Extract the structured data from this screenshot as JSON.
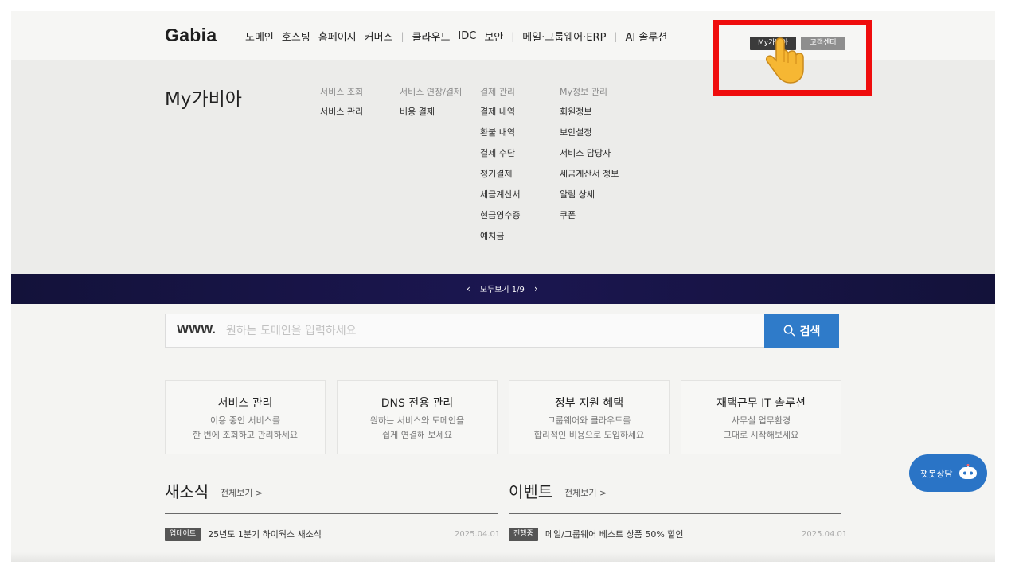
{
  "header": {
    "logo": "Gabia",
    "nav_groups": [
      [
        "도메인",
        "호스팅",
        "홈페이지",
        "커머스"
      ],
      [
        "클라우드",
        "IDC",
        "보안"
      ],
      [
        "메일·그룹웨어·ERP"
      ],
      [
        "AI 솔루션"
      ]
    ],
    "util": {
      "my_label": "My가비아",
      "cs_label": "고객센터"
    }
  },
  "megamenu": {
    "title": "My가비아",
    "columns": [
      {
        "head": "서비스 조회",
        "links": [
          "서비스 관리"
        ]
      },
      {
        "head": "서비스 연장/결제",
        "links": [
          "비용 결제"
        ]
      },
      {
        "head": "결제 관리",
        "links": [
          "결제 내역",
          "환불 내역",
          "결제 수단",
          "정기결제",
          "세금계산서",
          "현금영수증",
          "예치금"
        ]
      },
      {
        "head": "My정보 관리",
        "links": [
          "회원정보",
          "보안설정",
          "서비스 담당자",
          "세금계산서 정보",
          "알림 상세",
          "쿠폰"
        ]
      }
    ]
  },
  "banner": {
    "label": "모두보기 1/9"
  },
  "search": {
    "prefix": "WWW.",
    "placeholder": "원하는 도메인을 입력하세요",
    "button_label": "검색"
  },
  "cards": [
    {
      "title": "서비스 관리",
      "desc": "이용 중인 서비스를\n한 번에 조회하고 관리하세요"
    },
    {
      "title": "DNS 전용 관리",
      "desc": "원하는 서비스와 도메인을\n쉽게 연결해 보세요"
    },
    {
      "title": "정부 지원 혜택",
      "desc": "그룹웨어와 클라우드를\n합리적인 비용으로 도입하세요"
    },
    {
      "title": "재택근무 IT 솔루션",
      "desc": "사무실 업무환경\n그대로 시작해보세요"
    }
  ],
  "news": {
    "title": "새소식",
    "more": "전체보기 >",
    "items": [
      {
        "badge": "업데이트",
        "text": "25년도 1분기 하이웍스 새소식",
        "date": "2025.04.01"
      }
    ]
  },
  "events": {
    "title": "이벤트",
    "more": "전체보기 >",
    "items": [
      {
        "badge": "진행중",
        "text": "메일/그룹웨어 베스트 상품 50% 할인",
        "date": "2025.04.01"
      }
    ]
  },
  "chatbot": {
    "label": "챗봇상담"
  },
  "colors": {
    "highlight": "#ef0d0d",
    "search_button": "#2f7bc9",
    "banner": "#1b1650",
    "chatbot": "#2a74c6"
  },
  "icons": [
    "search-icon",
    "pointing-hand-icon",
    "chevron-left-icon",
    "chevron-right-icon",
    "chatbot-icon"
  ]
}
